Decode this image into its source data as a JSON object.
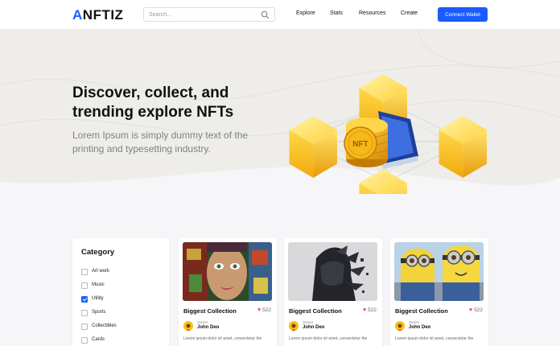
{
  "nav": {
    "logo_a": "A",
    "logo_n": "N",
    "logo_rest": "FTIZ",
    "search_placeholder": "Search...",
    "menu": [
      "Explore",
      "Stats",
      "Resources",
      "Create"
    ],
    "connect_label": "Connect Wallet"
  },
  "hero": {
    "title": "Discover, collect, and trending explore NFTs",
    "subtitle": "Lorem Ipsum is simply dummy text of the printing and typesetting industry.",
    "coin_label": "NFT"
  },
  "category": {
    "title": "Category",
    "items": [
      {
        "label": "Art work",
        "checked": false
      },
      {
        "label": "Music",
        "checked": false
      },
      {
        "label": "Utility",
        "checked": true
      },
      {
        "label": "Sports",
        "checked": false
      },
      {
        "label": "Collectibles",
        "checked": false
      },
      {
        "label": "Cards",
        "checked": false
      }
    ]
  },
  "cards": [
    {
      "title": "Biggest Collection",
      "likes": "522",
      "owner_label": "Owner",
      "owner_name": "John Deo",
      "desc": "Lorem ipsum dolor sit amet, consectetur the"
    },
    {
      "title": "Biggest Collection",
      "likes": "522",
      "owner_label": "Owner",
      "owner_name": "John Deo",
      "desc": "Lorem ipsum dolor sit amet, consectetur the"
    },
    {
      "title": "Biggest Collection",
      "likes": "522",
      "owner_label": "Owner",
      "owner_name": "John Deo",
      "desc": "Lorem ipsum dolor sit amet, consectetur the"
    }
  ],
  "colors": {
    "accent": "#1a5cff",
    "heart": "#e8424a",
    "gold": "#f4c20d"
  }
}
